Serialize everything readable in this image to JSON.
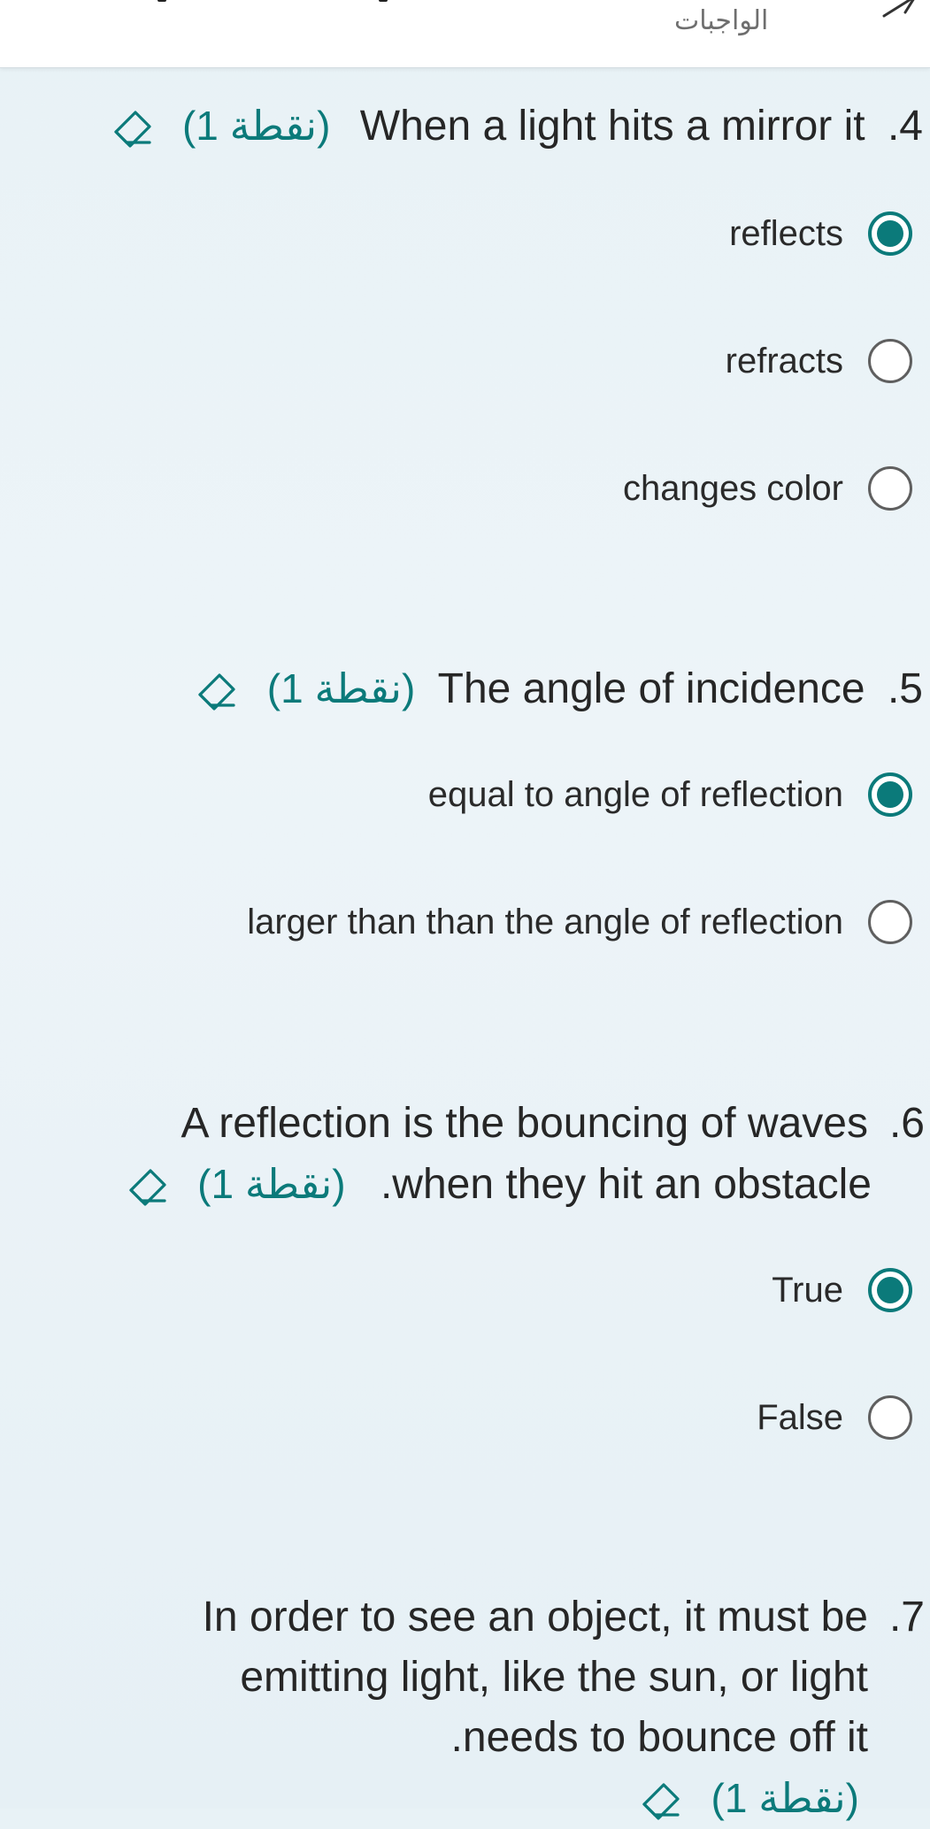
{
  "header": {
    "title": "الواجبات"
  },
  "questions": [
    {
      "number": ".4",
      "text": "When a light hits a mirror it",
      "points": "(1 نقطة)",
      "options": [
        {
          "label": "reflects",
          "selected": true
        },
        {
          "label": "refracts",
          "selected": false
        },
        {
          "label": "changes color",
          "selected": false
        }
      ]
    },
    {
      "number": ".5",
      "text": "The angle of incidence",
      "points": "(1 نقطة)",
      "options": [
        {
          "label": "equal to angle of reflection",
          "selected": true
        },
        {
          "label": "larger than than the angle of reflection",
          "selected": false
        }
      ]
    },
    {
      "number": ".6",
      "text_line1": "A reflection is the bouncing of waves",
      "text_line2": ".when they hit an obstacle",
      "points": "(1 نقطة)",
      "options": [
        {
          "label": "True",
          "selected": true
        },
        {
          "label": "False",
          "selected": false
        }
      ]
    },
    {
      "number": ".7",
      "text_line1": "In order to see an object, it must be",
      "text_line2": "emitting light, like  the sun, or light",
      "text_line3": ".needs to bounce off it",
      "points": "(1 نقطة)"
    }
  ],
  "colors": {
    "accent": "#0b7a7a",
    "text": "#262626",
    "background": "#eaf3f7"
  }
}
